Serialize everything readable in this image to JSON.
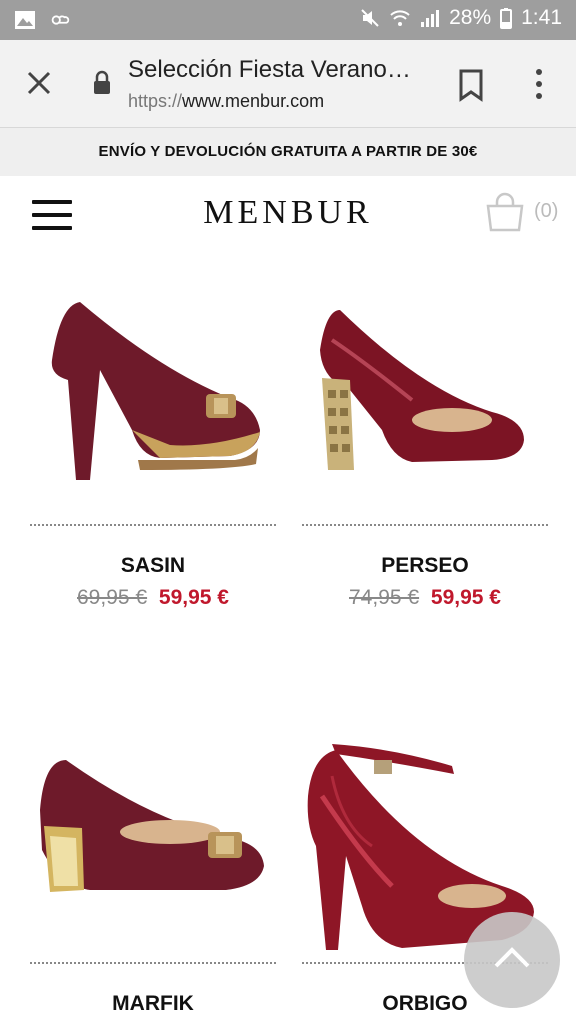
{
  "status_bar": {
    "battery": "28%",
    "time": "1:41"
  },
  "browser": {
    "title": "Selección Fiesta Verano…",
    "url_scheme": "https://",
    "url_host": "www.menbur.com"
  },
  "promo": {
    "text": "ENVÍO Y DEVOLUCIÓN GRATUITA A PARTIR DE 30€"
  },
  "header": {
    "logo": "MENBUR",
    "cart_count": "(0)"
  },
  "products": [
    {
      "name": "SASIN",
      "old_price": "69,95 €",
      "new_price": "59,95 €"
    },
    {
      "name": "PERSEO",
      "old_price": "74,95 €",
      "new_price": "59,95 €"
    },
    {
      "name": "MARFIK",
      "old_price": "",
      "new_price": ""
    },
    {
      "name": "ORBIGO",
      "old_price": "",
      "new_price": ""
    }
  ],
  "colors": {
    "accent_price": "#c0182c",
    "shoe_burgundy": "#6e1a2a",
    "shoe_red": "#8e1626"
  }
}
